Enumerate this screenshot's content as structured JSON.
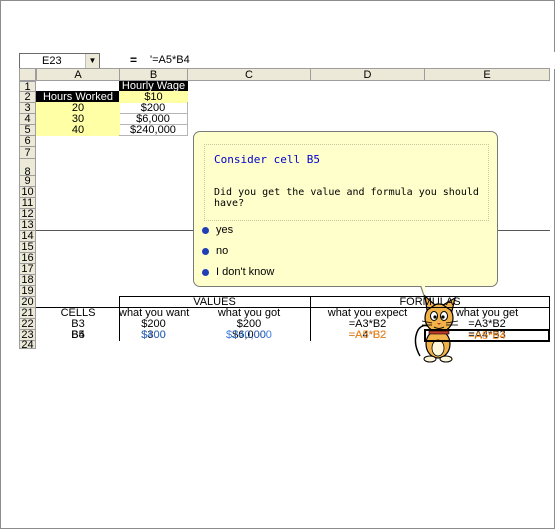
{
  "namebox": {
    "cell": "E23",
    "dropdown": "▼"
  },
  "formula_bar": {
    "eq": "=",
    "formula": "'=A5*B4"
  },
  "columns": [
    "A",
    "B",
    "C",
    "D",
    "E"
  ],
  "rows": [
    "1",
    "2",
    "3",
    "4",
    "5",
    "6",
    "7",
    "8",
    "9",
    "10",
    "11",
    "12",
    "13",
    "14",
    "15",
    "16",
    "17",
    "18",
    "19",
    "20",
    "21",
    "22",
    "23",
    "24"
  ],
  "cells": {
    "b1": "Hourly Wage",
    "a2": "Hours Worked",
    "b2": "$10",
    "a3": "20",
    "b3": "$200",
    "a4": "30",
    "b4": "$6,000",
    "a5": "40",
    "b5": "$240,000"
  },
  "balloon": {
    "title": "Consider cell B5",
    "question": "Did you get the value and formula you should have?",
    "options": [
      "yes",
      "no",
      "I don't know"
    ]
  },
  "table": {
    "values_header": "VALUES",
    "formulas_header": "FORMULAS",
    "col_headers": [
      "CELLS",
      "what you want",
      "what you got",
      "what you expect",
      "what you get"
    ],
    "rows": [
      [
        "B3",
        "$200",
        "$200",
        "=A3*B2",
        "=A3*B2"
      ],
      [
        "B4",
        "$300",
        "$6,000",
        "=A4*B2",
        "=A4*B3"
      ],
      [
        "B5",
        "$400",
        "$240,000",
        "=A5*B2",
        "=A5*B4"
      ]
    ]
  },
  "colors": {
    "blue": "#3d7bd9",
    "orange": "#ff8c1a",
    "header_bg": "#ece9d8",
    "highlight": "#ffffa6"
  }
}
